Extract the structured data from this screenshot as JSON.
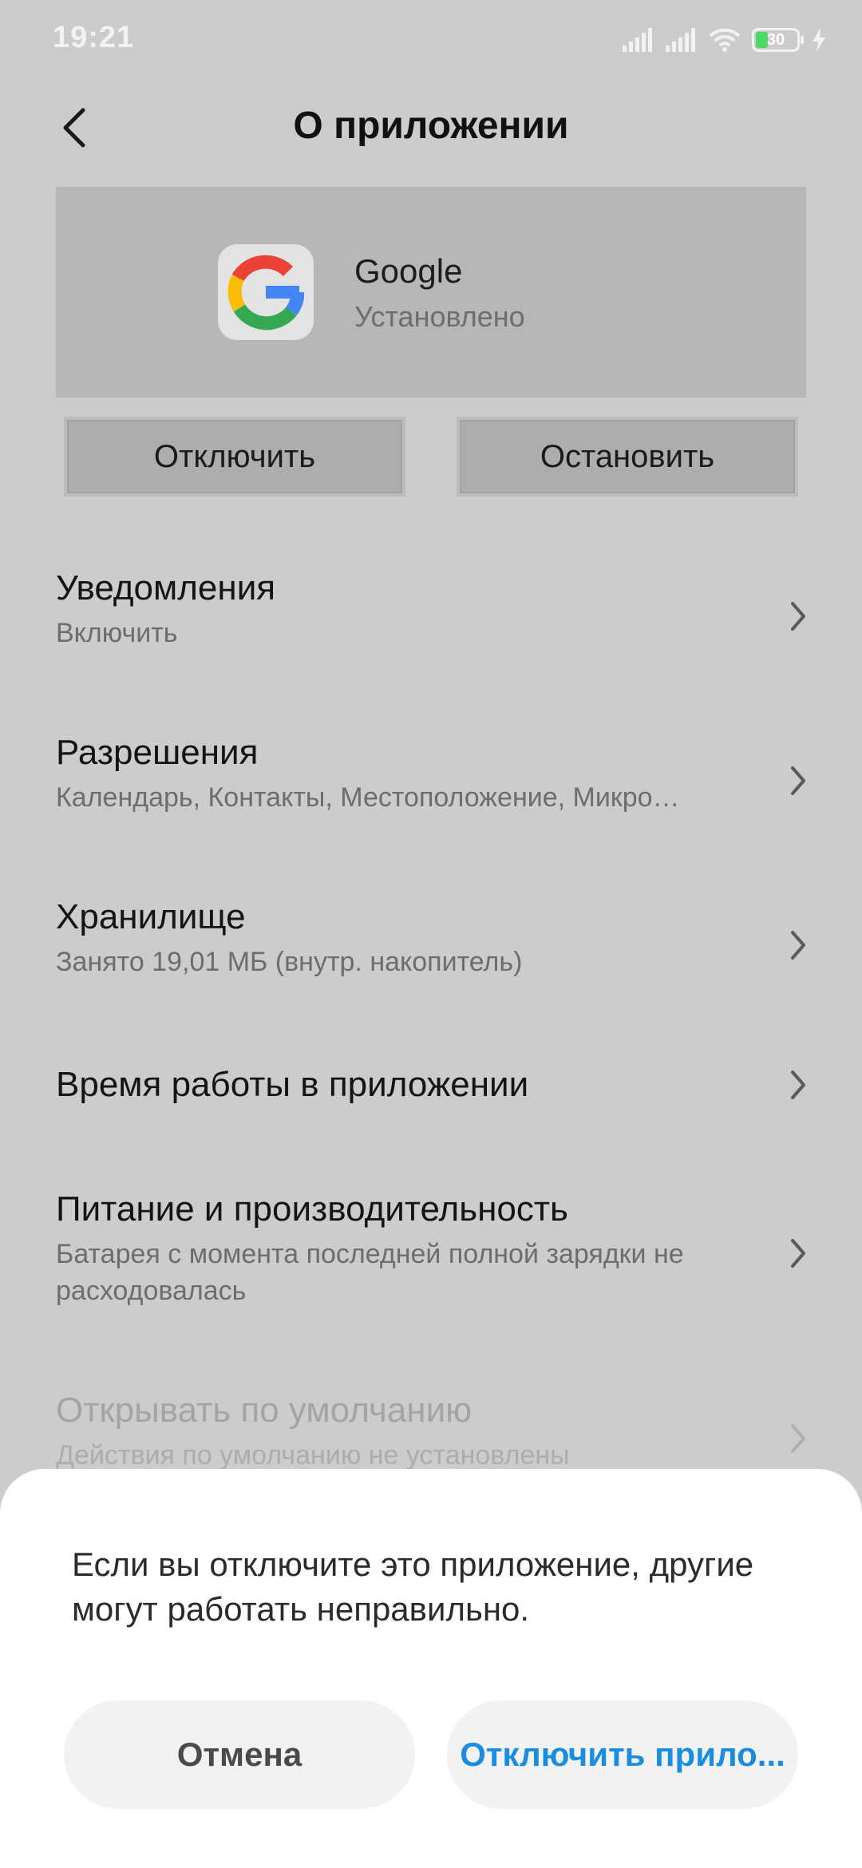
{
  "status_bar": {
    "time": "19:21",
    "battery_level": "30",
    "battery_fraction": 0.3,
    "charging": true,
    "icons": [
      "signal-icon",
      "signal-icon",
      "wifi-icon",
      "battery-icon",
      "charging-icon"
    ]
  },
  "header": {
    "title": "О приложении"
  },
  "app": {
    "name": "Google",
    "status": "Установлено"
  },
  "actions": {
    "disable_label": "Отключить",
    "stop_label": "Остановить"
  },
  "settings": [
    {
      "title": "Уведомления",
      "subtitle": "Включить"
    },
    {
      "title": "Разрешения",
      "subtitle": "Календарь, Контакты, Местоположение, Микро…"
    },
    {
      "title": "Хранилище",
      "subtitle": "Занято 19,01 МБ (внутр. накопитель)"
    },
    {
      "title": "Время работы в приложении",
      "subtitle": ""
    },
    {
      "title": "Питание и производительность",
      "subtitle": "Батарея с момента последней полной зарядки не расходовалась"
    },
    {
      "title": "Открывать по умолчанию",
      "subtitle": "Действия по умолчанию не установлены"
    }
  ],
  "dialog": {
    "message": "Если вы отключите это приложение, другие могут работать неправильно.",
    "cancel_label": "Отмена",
    "confirm_label": "Отключить прило..."
  },
  "colors": {
    "dim_background": "#cccccc",
    "app_card": "#b7b7b7",
    "accent": "#1a8de0",
    "battery_green": "#4cd964"
  }
}
